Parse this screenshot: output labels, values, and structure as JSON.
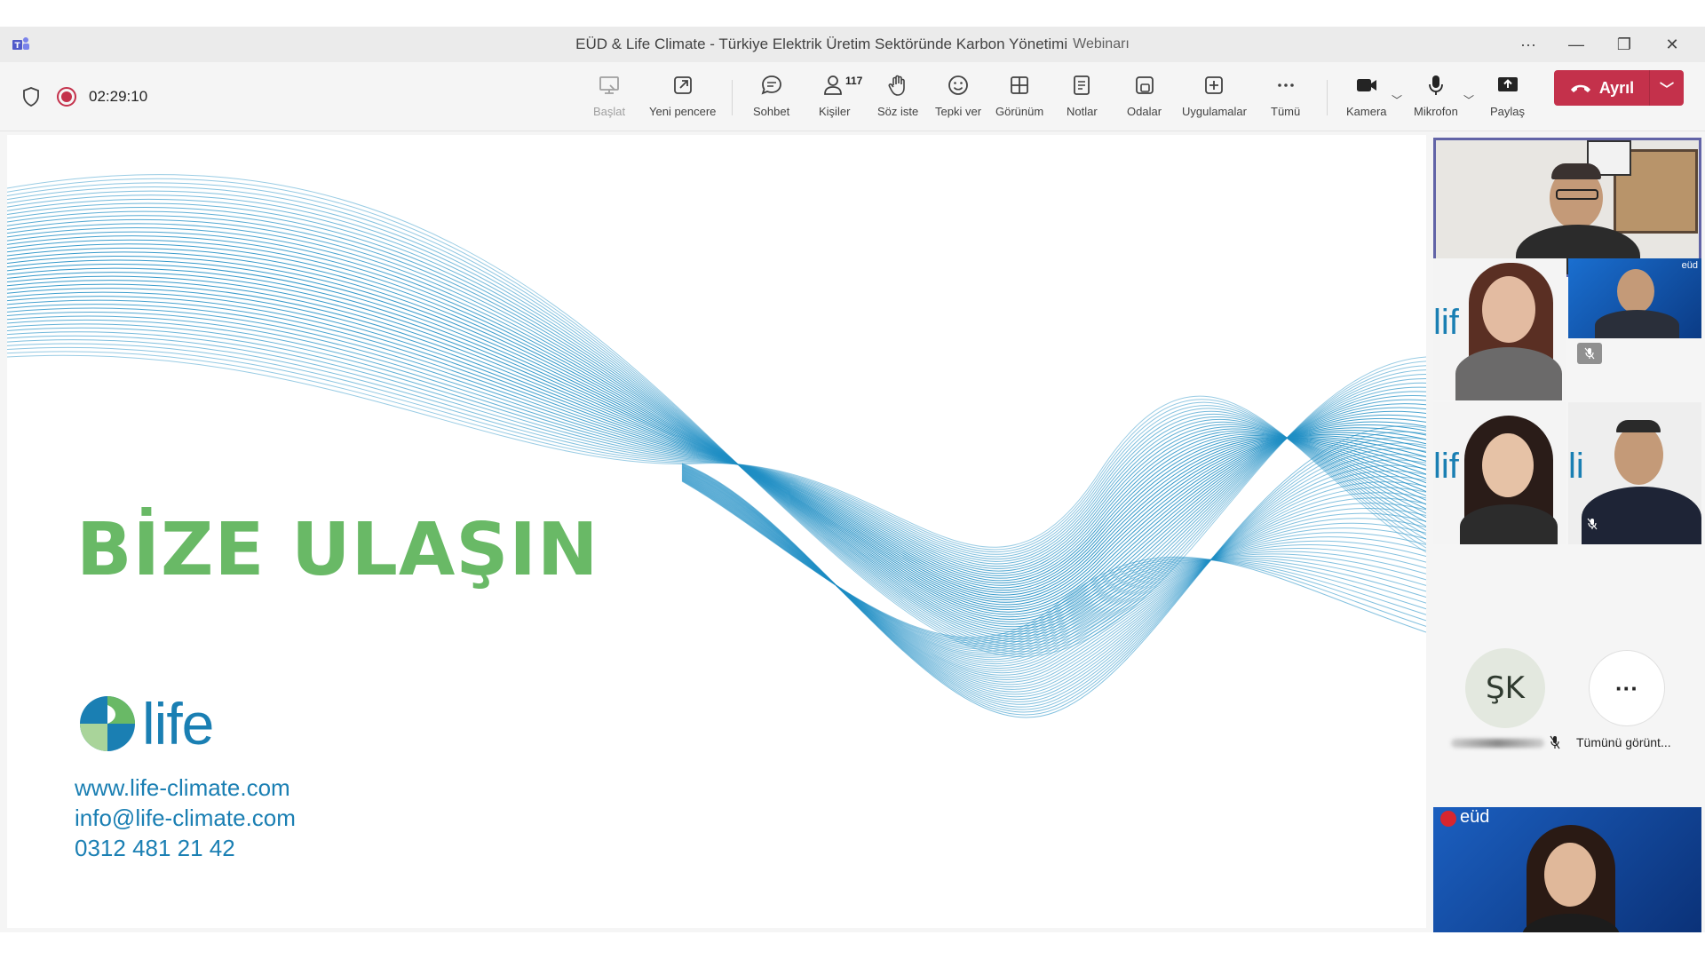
{
  "window": {
    "title": "EÜD & Life Climate - Türkiye Elektrik Üretim Sektöründe Karbon Yönetimi",
    "subtitle": "Webinarı",
    "controls": [
      "···",
      "—",
      "❐",
      "✕"
    ]
  },
  "meeting": {
    "timer": "02:29:10",
    "recording": true
  },
  "toolbar": {
    "buttons": [
      {
        "label": "Başlat",
        "icon": "present-icon",
        "enabled": false
      },
      {
        "label": "Yeni pencere",
        "icon": "pop-out-icon",
        "enabled": true
      },
      {
        "label": "Sohbet",
        "icon": "chat-icon",
        "enabled": true
      },
      {
        "label": "Kişiler",
        "icon": "people-icon",
        "enabled": true,
        "badge": "117"
      },
      {
        "label": "Söz iste",
        "icon": "raise-hand-icon",
        "enabled": true
      },
      {
        "label": "Tepki ver",
        "icon": "smiley-icon",
        "enabled": true
      },
      {
        "label": "Görünüm",
        "icon": "grid-icon",
        "enabled": true
      },
      {
        "label": "Notlar",
        "icon": "notes-icon",
        "enabled": true
      },
      {
        "label": "Odalar",
        "icon": "rooms-icon",
        "enabled": true
      },
      {
        "label": "Uygulamalar",
        "icon": "add-app-icon",
        "enabled": true
      },
      {
        "label": "Tümü",
        "icon": "more-icon",
        "enabled": true
      },
      {
        "label": "Kamera",
        "icon": "camera-icon",
        "enabled": true
      },
      {
        "label": "Mikrofon",
        "icon": "microphone-icon",
        "enabled": true
      },
      {
        "label": "Paylaş",
        "icon": "share-icon",
        "enabled": true
      }
    ],
    "leave_label": "Ayrıl"
  },
  "slide": {
    "title": "BİZE ULAŞIN",
    "logo_text": "life",
    "website": "www.life-climate.com",
    "email": "info@life-climate.com",
    "phone": "0312 481 21 42",
    "wave_color": "#1f8ec4",
    "title_color": "#69b966"
  },
  "participants": {
    "avatar_initials": "ŞK",
    "see_all_label": "Tümünü görünt...",
    "more_glyph": "···",
    "tile_logo_text": "lif",
    "tile_logo_text_short": "li",
    "eud_text": "eüd"
  },
  "colors": {
    "accent": "#6264a7",
    "leave": "#c4314b",
    "recording": "#c4314b"
  }
}
